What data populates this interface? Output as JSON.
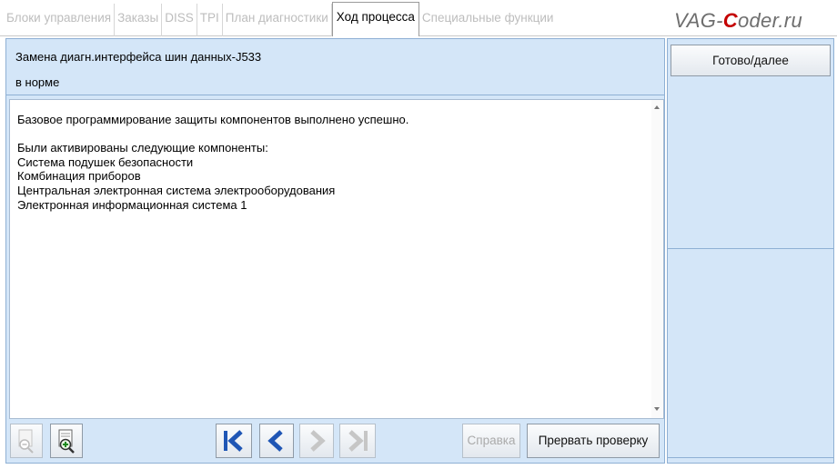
{
  "tabs": [
    {
      "label": "Блоки управления",
      "active": false
    },
    {
      "label": "Заказы",
      "active": false
    },
    {
      "label": "DISS",
      "active": false
    },
    {
      "label": "TPI",
      "active": false
    },
    {
      "label": "План диагностики",
      "active": false
    },
    {
      "label": "Ход процесса",
      "active": true
    },
    {
      "label": "Специальные функции",
      "active": false
    }
  ],
  "watermark": {
    "prefix": "VAG-",
    "accent": "C",
    "suffix": "oder.ru"
  },
  "header": {
    "title": "Замена диагн.интерфейса шин данных-J533",
    "status": "в норме"
  },
  "content": {
    "lines": [
      "Базовое программирование защиты компонентов выполнено успешно.",
      "",
      "Были активированы следующие компоненты:",
      "Система подушек безопасности",
      "Комбинация приборов",
      "Центральная электронная система электрооборудования",
      "Электронная информационная система 1"
    ]
  },
  "toolbar": {
    "icons": [
      "zoom-out-icon",
      "zoom-in-icon",
      "first-icon",
      "back-icon",
      "forward-icon",
      "last-icon"
    ],
    "help_label": "Справка",
    "abort_label": "Прервать проверку"
  },
  "side": {
    "done_label": "Готово/далее"
  },
  "colors": {
    "panel": "#d4e6f8",
    "nav_blue": "#1f56b5",
    "watermark_accent": "#c40000"
  }
}
